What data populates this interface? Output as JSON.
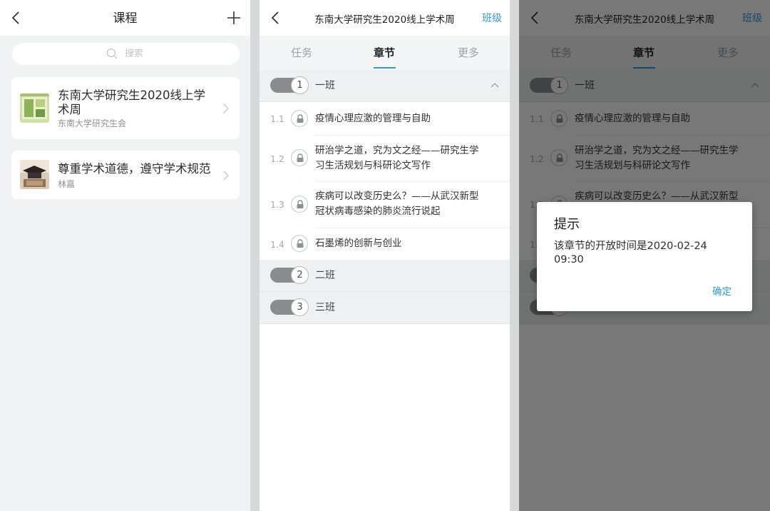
{
  "accent_color": "#2f9be0",
  "screen1": {
    "title": "课程",
    "search_placeholder": "搜索",
    "courses": [
      {
        "title": "东南大学研究生2020线上学术周",
        "subtitle": "东南大学研究生会"
      },
      {
        "title": "尊重学术道德，遵守学术规范",
        "subtitle": "林嘉"
      }
    ]
  },
  "screen2": {
    "title": "东南大学研究生2020线上学术周",
    "right_link": "班级",
    "tabs": [
      "任务",
      "章节",
      "更多"
    ],
    "active_tab": "章节",
    "groups": [
      {
        "number": "1",
        "label": "一班",
        "expanded": true
      },
      {
        "number": "2",
        "label": "二班"
      },
      {
        "number": "3",
        "label": "三班"
      }
    ],
    "chapters": [
      {
        "number": "1.1",
        "title": "疫情心理应激的管理与自助",
        "locked": true
      },
      {
        "number": "1.2",
        "title": "研治学之道，究为文之经——研究生学习生活规划与科研论文写作",
        "locked": true
      },
      {
        "number": "1.3",
        "title": "疾病可以改变历史么？——从武汉新型冠状病毒感染的肺炎流行说起",
        "locked": true
      },
      {
        "number": "1.4",
        "title": "石墨烯的创新与创业",
        "locked": true
      }
    ]
  },
  "dialog": {
    "title": "提示",
    "message": "该章节的开放时间是2020-02-24 09:30",
    "ok_label": "确定"
  }
}
